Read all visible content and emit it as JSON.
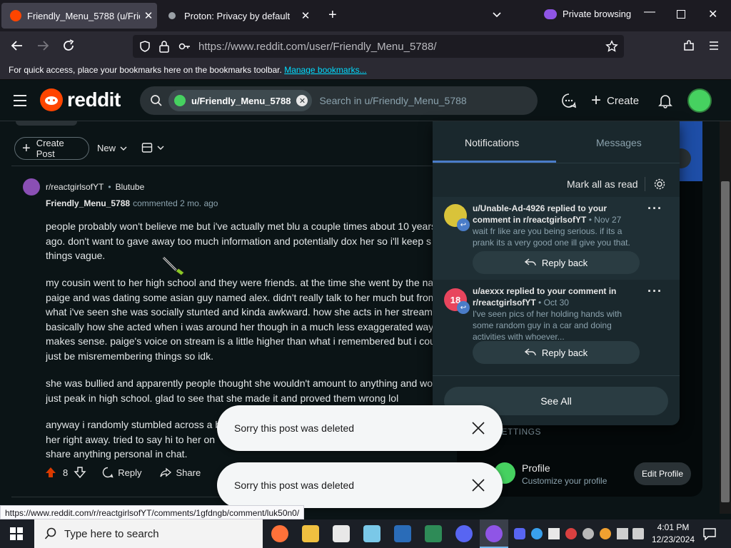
{
  "browser": {
    "tabs": [
      {
        "title": "Friendly_Menu_5788 (u/Friendly_",
        "active": true,
        "favicon_color": "#ff4500"
      },
      {
        "title": "Proton: Privacy by default",
        "active": false,
        "favicon_color": "#6d4aff"
      }
    ],
    "private_label": "Private browsing",
    "url": "https://www.reddit.com/user/Friendly_Menu_5788/",
    "bookmarks_hint": "For quick access, place your bookmarks here on the bookmarks toolbar.",
    "bookmarks_link": "Manage bookmarks..."
  },
  "reddit": {
    "logo_text": "reddit",
    "search_chip": "u/Friendly_Menu_5788",
    "search_placeholder": "Search in u/Friendly_Menu_5788",
    "create_label": "Create",
    "create_post_label": "Create Post",
    "sort_label": "New",
    "comment": {
      "subreddit": "r/reactgirlsofYT",
      "post_title": "Blutube",
      "author": "Friendly_Menu_5788",
      "meta": "commented 2 mo. ago",
      "paragraphs": [
        [
          "people probably won't believe me but i've actually met blu a couple times about 10 years",
          "ago. don't want to gave away too much information and potentially dox her so i'll keep s",
          "things vague."
        ],
        [
          "my cousin went to her high school and they were friends. at the time she went by the na",
          "paige and was dating some asian guy named alex. didn't really talk to her much but from",
          "what i've seen she was socially stunted and kinda awkward. how she acts in her streams i",
          "basically how she acted when i was around her though in a much less exaggerated way if",
          "makes sense. paige's voice on stream is a little higher than what i remembered but i coul",
          "just be misremembering things so idk."
        ],
        [
          "she was bullied and apparently people thought she wouldn't amount to anything and wo",
          "just peak in high school. glad to see that she made it and proved them wrong lol"
        ],
        [
          "anyway i randomly stumbled across a b",
          "her right away. tried to say hi to her on",
          "share anything personal in chat."
        ]
      ],
      "votes": "8",
      "reply_label": "Reply",
      "share_label": "Share"
    },
    "notifications": {
      "tab_notifications": "Notifications",
      "tab_messages": "Messages",
      "mark_all_read": "Mark all as read",
      "items": [
        {
          "text": "u/Unable-Ad-4926 replied to your comment in r/reactgirlsofYT",
          "time": "Nov 27",
          "preview": "wait fr like are you being serious. if its a prank its a very good one ill give you that.",
          "reply_label": "Reply back",
          "avatar_color": "#d9c33a"
        },
        {
          "text": "u/aexxx replied to your comment in r/reactgirlsofYT",
          "time": "Oct 30",
          "preview": "I've seen pics of her holding hands with some random guy in a car and doing activities with whoever...",
          "reply_label": "Reply back",
          "avatar_color": "#e8455d",
          "avatar_text": "18"
        }
      ],
      "see_all": "See All"
    },
    "sidebar": {
      "settings_label": "SETTINGS",
      "profile_title": "Profile",
      "profile_sub": "Customize your profile",
      "edit_profile": "Edit Profile"
    },
    "toasts": [
      "Sorry this post was deleted",
      "Sorry this post was deleted"
    ]
  },
  "status_url": "https://www.reddit.com/r/reactgirlsofYT/comments/1gfdngb/comment/luk50n0/",
  "taskbar": {
    "search_placeholder": "Type here to search",
    "time": "4:01 PM",
    "date": "12/23/2024"
  }
}
